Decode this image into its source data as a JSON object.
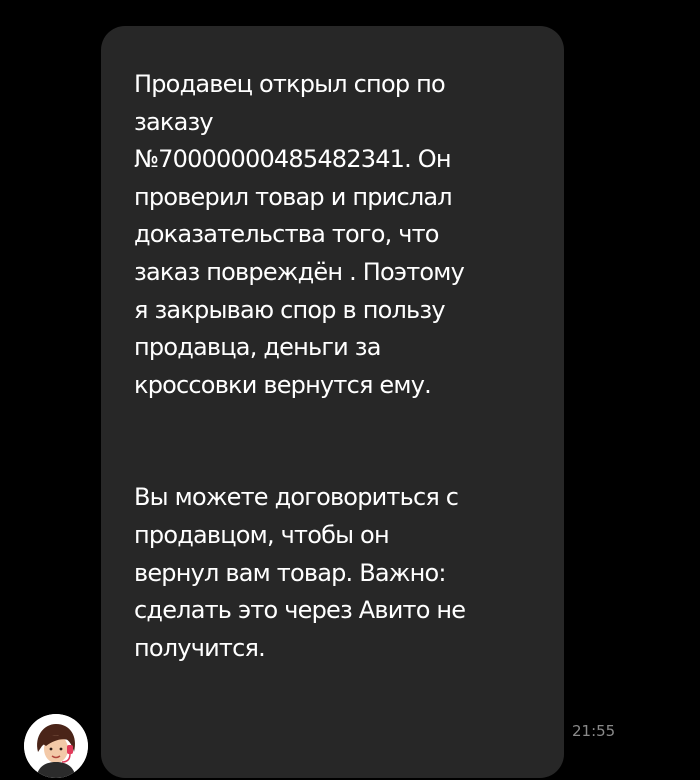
{
  "message": {
    "paragraphs": [
      "Продавец открыл спор по\nзаказу\n№70000000485482341. Он\nпроверил товар и прислал\nдоказательства того, что\nзаказ повреждён . Поэтому\nя закрываю спор в пользу\nпродавца, деньги за\nкроссовки вернутся ему.",
      "Вы можете договориться с\nпродавцом, чтобы он\nвернул вам товар. Важно:\nсделать это через Авито не\nполучится."
    ],
    "time": "21:55"
  },
  "sender": {
    "avatar_icon": "support-agent-avatar"
  },
  "colors": {
    "background": "#000000",
    "bubble": "#272727",
    "text": "#ffffff",
    "time": "#8a8a8a"
  }
}
